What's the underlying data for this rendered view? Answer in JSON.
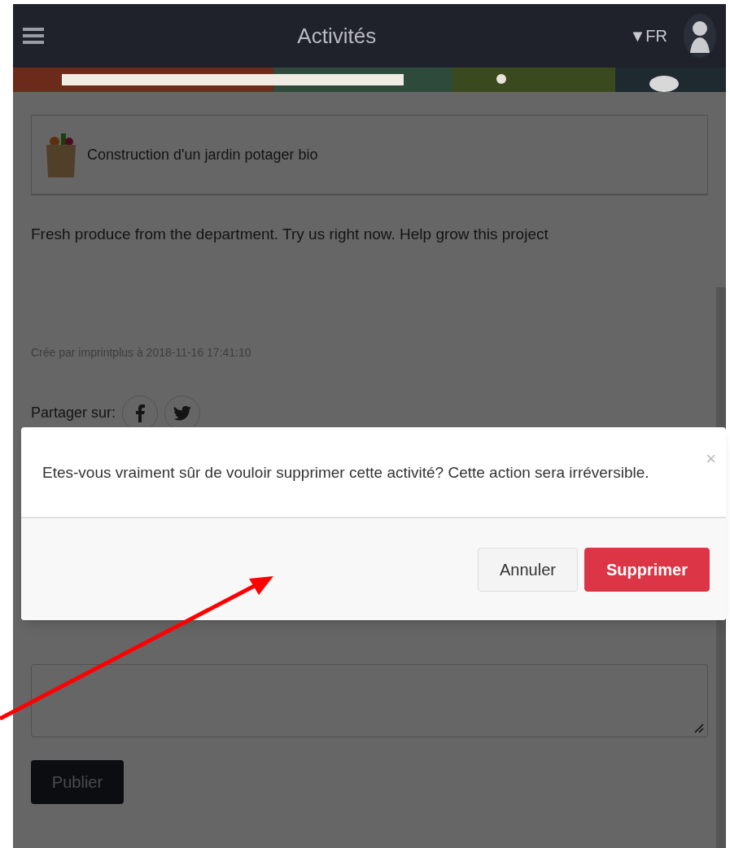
{
  "header": {
    "title": "Activités",
    "language": "▼FR"
  },
  "project": {
    "title": "Construction d'un jardin potager bio",
    "description": "Fresh produce from the department. Try us right now. Help grow this project",
    "created": "Crée par imprintplus à 2018-11-16 17:41:10",
    "share_label": "Partager sur:"
  },
  "form": {
    "publish_button": "Publier"
  },
  "modal": {
    "message": "Etes-vous vraiment sûr de vouloir supprimer cette activité? Cette action sera irréversible.",
    "close": "×",
    "buttons": [
      {
        "label": "Annuler",
        "kind": "secondary"
      },
      {
        "label": "Supprimer",
        "kind": "danger"
      }
    ]
  }
}
